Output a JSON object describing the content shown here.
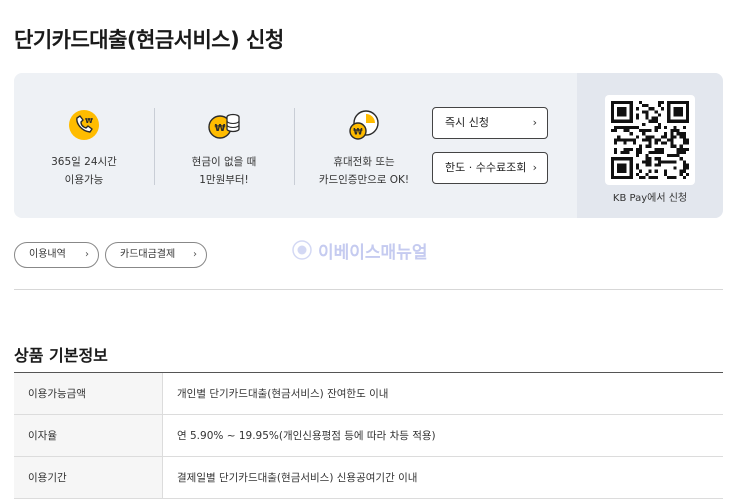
{
  "page": {
    "title": "단기카드대출(현금서비스) 신청"
  },
  "banner": {
    "features": [
      {
        "icon": "phone-won-icon",
        "lines": [
          "365일 24시간",
          "이용가능"
        ]
      },
      {
        "icon": "coins-won-icon",
        "lines": [
          "현금이 없을 때",
          "1만원부터!"
        ]
      },
      {
        "icon": "clock-won-icon",
        "lines": [
          "휴대전화 또는",
          "카드인증만으로 OK!"
        ]
      }
    ],
    "buttons": {
      "apply_now": "즉시 신청",
      "limit_fee": "한도 · 수수료조회"
    },
    "qr": {
      "label": "KB Pay에서 신청"
    },
    "colors": {
      "accent": "#ffbc00",
      "background": "#eef1f5"
    }
  },
  "links": {
    "usage_history": "이용내역",
    "card_loan_payment": "카드대금결제"
  },
  "watermark": {
    "text": "이베이스매뉴얼"
  },
  "info": {
    "title": "상품 기본정보",
    "rows": [
      {
        "label": "이용가능금액",
        "value": "개인별 단기카드대출(현금서비스) 잔여한도 이내"
      },
      {
        "label": "이자율",
        "value": "연 5.90% ~ 19.95%(개인신용평점 등에 따라 차등 적용)"
      },
      {
        "label": "이용기간",
        "value": "결제일별 단기카드대출(현금서비스) 신용공여기간 이내"
      }
    ]
  }
}
